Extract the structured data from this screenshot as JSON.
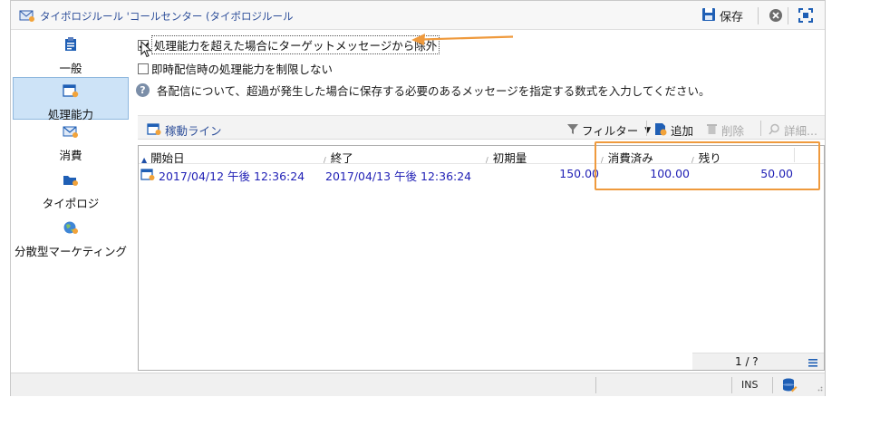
{
  "window": {
    "title": "タイポロジルール 'コールセンター (タイポロジルール",
    "save_label": "保存"
  },
  "sidebar": {
    "items": [
      {
        "label": "一般",
        "icon": "clipboard-icon",
        "active": false
      },
      {
        "label": "処理能力",
        "icon": "calendar-capacity-icon",
        "active": true
      },
      {
        "label": "消費",
        "icon": "envelope-consumption-icon",
        "active": false
      },
      {
        "label": "タイポロジ",
        "icon": "folder-typology-icon",
        "active": false
      },
      {
        "label": "分散型マーケティング",
        "icon": "globe-marketing-icon",
        "active": false
      }
    ]
  },
  "options": {
    "exclude_label": "処理能力を超えた場合にターゲットメッセージから除外",
    "exclude_checked": true,
    "limit_label": "即時配信時の処理能力を制限しない",
    "limit_checked": false,
    "help_text": "各配信について、超過が発生した場合に保存する必要のあるメッセージを指定する数式を入力してください。"
  },
  "grid_toolbar": {
    "lines_label": "稼動ライン",
    "filter_label": "フィルター",
    "add_label": "追加",
    "delete_label": "削除",
    "details_label": "詳細..."
  },
  "grid": {
    "columns": [
      "開始日",
      "終了",
      "初期量",
      "消費済み",
      "残り"
    ],
    "rows": [
      {
        "start": "2017/04/12 午後 12:36:24",
        "end": "2017/04/13 午後 12:36:24",
        "initial": "150.00",
        "consumed": "100.00",
        "remaining": "50.00"
      }
    ],
    "pager": "1 / ?"
  },
  "status": {
    "ins": "INS"
  },
  "colors": {
    "accent_orange": "#ef9a3d",
    "value_blue": "#1f1fb5",
    "active_nav": "#cde3f7"
  }
}
